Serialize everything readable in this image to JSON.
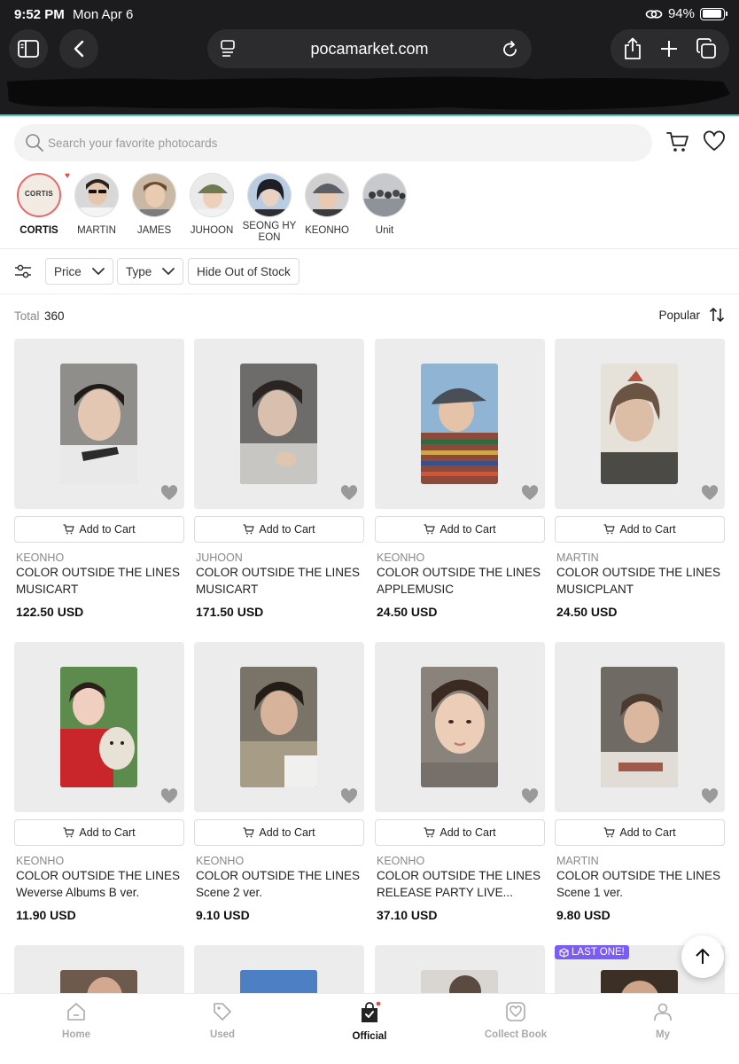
{
  "status_bar": {
    "time": "9:52 PM",
    "date": "Mon Apr 6",
    "battery": "94%",
    "battery_level": 0.94
  },
  "browser": {
    "url": "pocamarket.com"
  },
  "search": {
    "placeholder": "Search your favorite photocards"
  },
  "artists": [
    {
      "name": "CORTIS",
      "logo_text": "CORTIS",
      "active": true
    },
    {
      "name": "MARTIN"
    },
    {
      "name": "JAMES"
    },
    {
      "name": "JUHOON"
    },
    {
      "name": "SEONG HY\nEON"
    },
    {
      "name": "KEONHO"
    },
    {
      "name": "Unit"
    }
  ],
  "filters": {
    "price": "Price",
    "type": "Type",
    "stock": "Hide Out of Stock"
  },
  "results": {
    "total_label": "Total",
    "total_count": "360",
    "sort_label": "Popular"
  },
  "cart_label": "Add to Cart",
  "products": [
    {
      "artist": "KEONHO",
      "title_line1": "COLOR OUTSIDE THE LINES",
      "title_line2": "MUSICART",
      "price": "122.50 USD"
    },
    {
      "artist": "JUHOON",
      "title_line1": "COLOR OUTSIDE THE LINES",
      "title_line2": "MUSICART",
      "price": "171.50 USD"
    },
    {
      "artist": "KEONHO",
      "title_line1": "COLOR OUTSIDE THE LINES",
      "title_line2": "APPLEMUSIC",
      "price": "24.50 USD"
    },
    {
      "artist": "MARTIN",
      "title_line1": "COLOR OUTSIDE THE LINES",
      "title_line2": "MUSICPLANT",
      "price": "24.50 USD"
    },
    {
      "artist": "KEONHO",
      "title_line1": "COLOR OUTSIDE THE LINES",
      "title_line2": "Weverse Albums B ver.",
      "price": "11.90 USD"
    },
    {
      "artist": "KEONHO",
      "title_line1": "COLOR OUTSIDE THE LINES",
      "title_line2": "Scene 2 ver.",
      "price": "9.10 USD"
    },
    {
      "artist": "KEONHO",
      "title_line1": "COLOR OUTSIDE THE LINES",
      "title_line2": "RELEASE PARTY LIVE...",
      "price": "37.10 USD"
    },
    {
      "artist": "MARTIN",
      "title_line1": "COLOR OUTSIDE THE LINES",
      "title_line2": "Scene 1 ver.",
      "price": "9.80 USD"
    }
  ],
  "badge": {
    "last_one": "LAST ONE!"
  },
  "bottom_nav": [
    {
      "label": "Home",
      "icon": "home-icon"
    },
    {
      "label": "Used",
      "icon": "tag-icon"
    },
    {
      "label": "Official",
      "icon": "shopping-bag-icon",
      "active": true
    },
    {
      "label": "Collect Book",
      "icon": "heart-book-icon"
    },
    {
      "label": "My",
      "icon": "person-icon"
    }
  ],
  "colors": {
    "accent_teal": "#47c6b5",
    "badge_purple": "#7b5cf5",
    "active_ring": "#e46a6a",
    "chrome_dark": "#1c1c1e"
  }
}
